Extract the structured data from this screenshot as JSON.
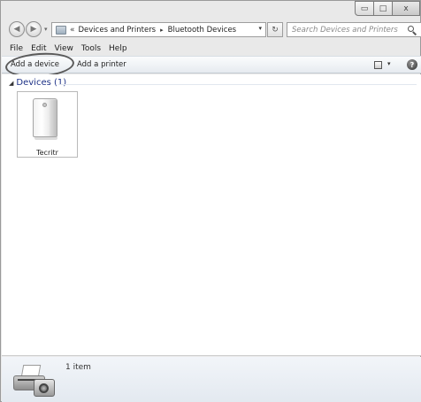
{
  "window": {
    "caption_buttons": {
      "minimize": "▭",
      "maximize": "□",
      "close": "x"
    }
  },
  "address_bar": {
    "overflow_chevron": "«",
    "crumbs": [
      "Devices and Printers",
      "Bluetooth Devices"
    ],
    "separator": "▸",
    "dropdown": "▾"
  },
  "nav": {
    "back": "◀",
    "forward": "▶",
    "recent_dropdown": "▾",
    "refresh": "↻"
  },
  "search": {
    "placeholder": "Search Devices and Printers"
  },
  "menu": [
    "File",
    "Edit",
    "View",
    "Tools",
    "Help"
  ],
  "command_bar": {
    "add_device_label": "Add a device",
    "add_printer_label": "Add a printer",
    "view_dropdown": "▾",
    "help_glyph": "?"
  },
  "content": {
    "group": {
      "collapse_glyph": "◢",
      "label": "Devices (1)"
    },
    "devices": [
      {
        "name": "Tecritr",
        "icon": "speaker-icon"
      }
    ]
  },
  "details_pane": {
    "icon": "printer-camera-icon",
    "count_text": "1 item"
  }
}
